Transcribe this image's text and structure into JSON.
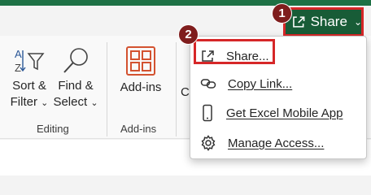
{
  "share_button": {
    "label": "Share",
    "caret": "⌄"
  },
  "ribbon": {
    "editing": {
      "sort_filter": {
        "line1": "Sort &",
        "line2": "Filter",
        "caret": "⌄"
      },
      "find_select": {
        "line1": "Find &",
        "line2": "Select",
        "caret": "⌄"
      },
      "group_label": "Editing"
    },
    "addins": {
      "label": "Add-ins",
      "group_label": "Add-ins"
    },
    "partial_label": "C"
  },
  "menu": {
    "items": [
      {
        "label": "Share...",
        "icon": "share-icon"
      },
      {
        "label": "Copy Link...",
        "icon": "link-icon"
      },
      {
        "label": "Get Excel Mobile App",
        "icon": "phone-icon"
      },
      {
        "label": "Manage Access...",
        "icon": "gear-icon"
      }
    ]
  },
  "callouts": {
    "badge1": "1",
    "badge2": "2"
  },
  "colors": {
    "excel_green": "#1e7145",
    "share_green": "#185c37",
    "highlight_red": "#d62728",
    "badge_red": "#7f1d1d"
  }
}
